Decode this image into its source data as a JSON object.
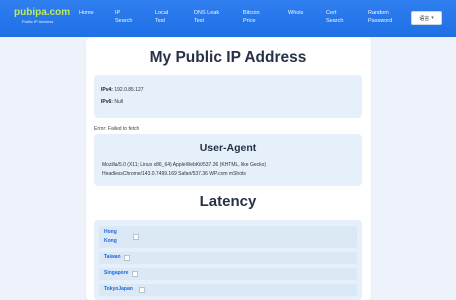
{
  "header": {
    "brand": "pubipa.com",
    "brand_sub": "Public IP Address",
    "nav": [
      {
        "lines": [
          "Home"
        ]
      },
      {
        "lines": [
          "IP",
          "Search"
        ]
      },
      {
        "lines": [
          "Local",
          "Test"
        ]
      },
      {
        "lines": [
          "DNS Leak",
          "Test"
        ]
      },
      {
        "lines": [
          "Bitcoin",
          "Price"
        ]
      },
      {
        "lines": [
          "Whois"
        ]
      },
      {
        "lines": [
          "Cert",
          "Search"
        ]
      },
      {
        "lines": [
          "Random",
          "Password"
        ]
      }
    ],
    "language": "语言"
  },
  "main": {
    "title": "My Public IP Address",
    "ipv4_label": "IPv4:",
    "ipv4_value": "192.0.85.127",
    "ipv6_label": "IPv6:",
    "ipv6_value": "Null",
    "error": "Error: Failed to fetch",
    "ua_title": "User-Agent",
    "ua_line1": "Mozilla/5.0 (X11; Linux x86_64) AppleWebKit/537.36 (KHTML, like Gecko)",
    "ua_line2": "HeadlessChrome/143.0.7499.169 Safari/537.36 WP.com mShots",
    "latency_title": "Latency",
    "latency": [
      {
        "lines": [
          "Hong",
          "Kong"
        ]
      },
      {
        "lines": [
          "Taiwan"
        ]
      },
      {
        "lines": [
          "Singapore"
        ]
      },
      {
        "lines": [
          "TokyoJapan"
        ]
      }
    ]
  }
}
